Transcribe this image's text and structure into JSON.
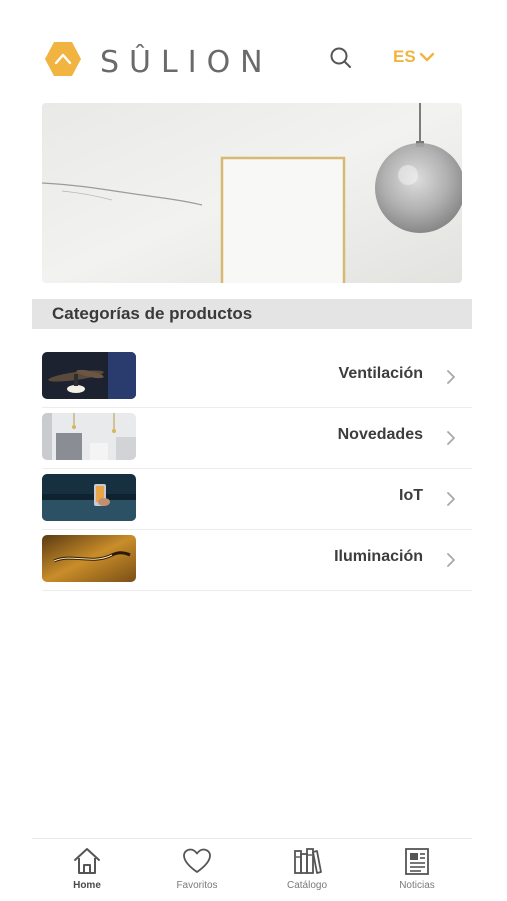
{
  "header": {
    "brand": "SÛLION",
    "language": "ES"
  },
  "icons": {
    "logo": "hexagon-chevron-logo-icon",
    "search": "search-icon",
    "language_caret": "chevron-down-icon",
    "row_chevron": "chevron-right-icon",
    "home": "home-icon",
    "favorites": "heart-icon",
    "catalog": "books-icon",
    "news": "newspaper-icon"
  },
  "colors": {
    "accent": "#f2b441",
    "section_bg": "#e4e4e4"
  },
  "section": {
    "title": "Categorías de productos"
  },
  "categories": [
    {
      "label": "Ventilación"
    },
    {
      "label": "Novedades"
    },
    {
      "label": "IoT"
    },
    {
      "label": "Iluminación"
    }
  ],
  "tabbar": {
    "tabs": [
      {
        "label": "Home"
      },
      {
        "label": "Favoritos"
      },
      {
        "label": "Catálogo"
      },
      {
        "label": "Noticias"
      }
    ]
  }
}
